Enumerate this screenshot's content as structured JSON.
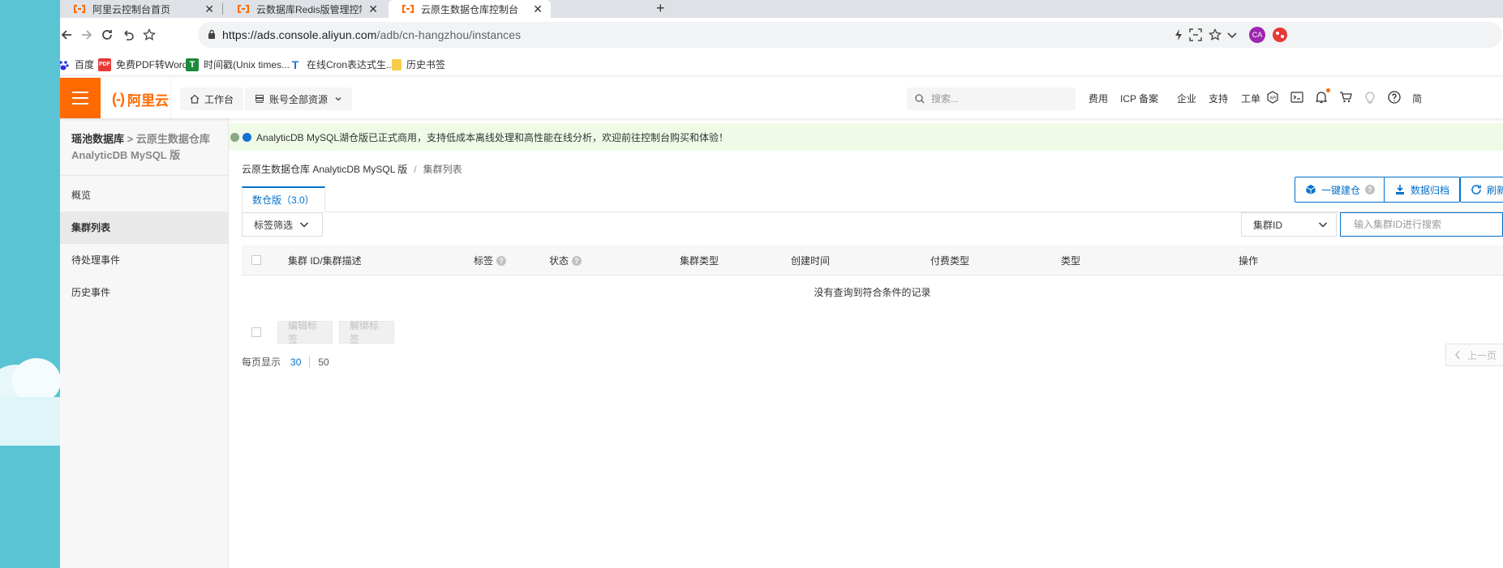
{
  "browser": {
    "tabs": [
      {
        "title": "阿里云控制台首页",
        "active": false
      },
      {
        "title": "云数据库Redis版管理控制台",
        "active": false
      },
      {
        "title": "云原生数据仓库控制台",
        "active": true
      }
    ],
    "new_tab": "+",
    "url_host": "https://ads.console.aliyun.com",
    "url_path": "/adb/cn-hangzhou/instances",
    "profile_initials": "CA",
    "bookmarks": [
      {
        "label": "百度",
        "icon": "baidu-icon"
      },
      {
        "label": "免费PDF转Word",
        "icon": "pdf-icon"
      },
      {
        "label": "时间戳(Unix times...",
        "icon": "timestamp-icon"
      },
      {
        "label": "在线Cron表达式生...",
        "icon": "cron-icon"
      },
      {
        "label": "历史书签",
        "icon": "folder-icon"
      }
    ]
  },
  "topbar": {
    "logo_text": "阿里云",
    "logo_bracket": "(-)",
    "workbench": "工作台",
    "resources": "账号全部资源",
    "search_placeholder": "搜索...",
    "links": [
      "费用",
      "ICP 备案",
      "企业",
      "支持",
      "工单"
    ],
    "lang": "简",
    "brand_color": "#ff6a00"
  },
  "sidebar": {
    "title_strong": "瑶池数据库",
    "title_sep": " > ",
    "title_muted": "云原生数据仓库 AnalyticDB MySQL 版",
    "items": [
      {
        "label": "概览",
        "active": false
      },
      {
        "label": "集群列表",
        "active": true
      },
      {
        "label": "待处理事件",
        "active": false
      },
      {
        "label": "历史事件",
        "active": false
      }
    ]
  },
  "main": {
    "banner": "AnalyticDB MySQL湖仓版已正式商用，支持低成本离线处理和高性能在线分析，欢迎前往控制台购买和体验！",
    "breadcrumb": {
      "parent": "云原生数据仓库 AnalyticDB MySQL 版",
      "current": "集群列表"
    },
    "tab_label": "数仓版（3.0）",
    "buttons": {
      "create": "一键建仓",
      "archive": "数据归档",
      "refresh": "刷新"
    },
    "filter_label": "标签筛选",
    "search_field": "集群ID",
    "search_placeholder": "输入集群ID进行搜索",
    "columns": [
      "集群 ID/集群描述",
      "标签",
      "状态",
      "集群类型",
      "创建时间",
      "付费类型",
      "类型",
      "操作"
    ],
    "empty_text": "没有查询到符合条件的记录",
    "edit_tags": "编辑标签",
    "remove_tags": "解绑标签",
    "page_size_label": "每页显示",
    "page_sizes": [
      "30",
      "50"
    ],
    "prev_page": "上一页",
    "accent_color": "#0070cc"
  }
}
